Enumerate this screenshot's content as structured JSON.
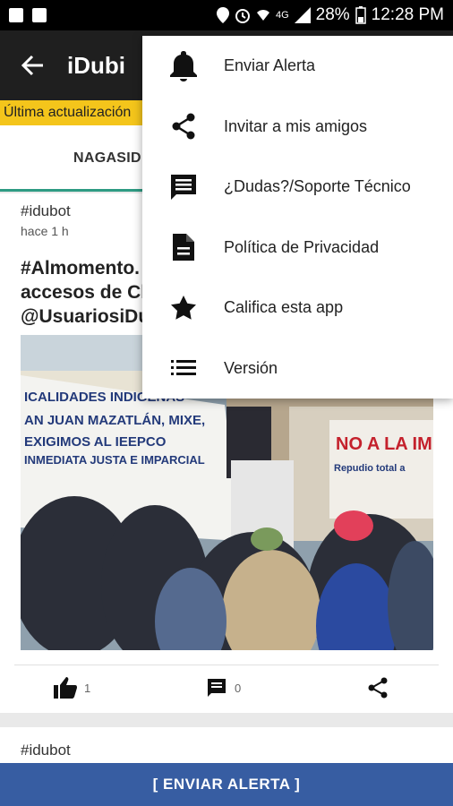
{
  "status_bar": {
    "battery": "28%",
    "time": "12:28 PM",
    "network": "4G"
  },
  "app_bar": {
    "title": "iDubi"
  },
  "update_bar": {
    "text": "Última actualización"
  },
  "tabs": [
    {
      "label": "NAGASID"
    }
  ],
  "post": {
    "author": "#idubot",
    "time": "hace 1 h",
    "text_lines": [
      "#Almomento.",
      "accesos de Cl",
      "@UsuariosiDu"
    ],
    "banner_left": [
      "ICALIDADES INDIGENAS",
      "AN JUAN MAZATLÁN, MIXE,",
      "EXIGIMOS AL IEEPCO",
      "INMEDIATA JUSTA E IMPARCIAL"
    ],
    "banner_right": [
      "NO A LA IMP",
      "Repudio total a"
    ],
    "likes": "1",
    "comments": "0"
  },
  "post2": {
    "author": "#idubot"
  },
  "bottom_button": {
    "label": "[ ENVIAR ALERTA ]"
  },
  "menu": {
    "items": [
      {
        "label": "Enviar Alerta",
        "icon": "bell-icon"
      },
      {
        "label": "Invitar a mis amigos",
        "icon": "share-icon"
      },
      {
        "label": "¿Dudas?/Soporte Técnico",
        "icon": "comment-icon"
      },
      {
        "label": "Política de Privacidad",
        "icon": "document-icon"
      },
      {
        "label": "Califica esta app",
        "icon": "star-icon"
      },
      {
        "label": "Versión",
        "icon": "list-icon"
      }
    ]
  },
  "colors": {
    "accent": "#2e9b83",
    "update_bar": "#f4c51b",
    "bottom_button": "#375da2",
    "app_bar": "#1f1f1f"
  }
}
